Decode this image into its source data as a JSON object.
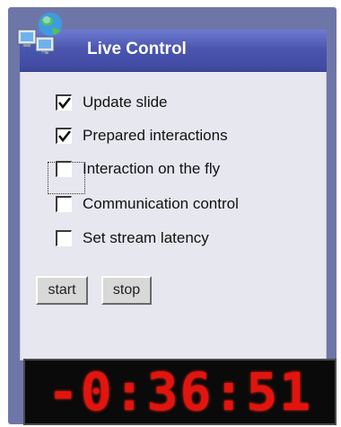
{
  "panel": {
    "title": "Live Control"
  },
  "options": [
    {
      "label": "Update slide",
      "checked": true
    },
    {
      "label": "Prepared interactions",
      "checked": true
    },
    {
      "label": "Interaction on the fly",
      "checked": false,
      "focused": true
    },
    {
      "label": "Communication control",
      "checked": false
    },
    {
      "label": "Set stream latency",
      "checked": false
    }
  ],
  "buttons": {
    "start": "start",
    "stop": "stop"
  },
  "clock": {
    "display": "-0:36:51"
  },
  "colors": {
    "frame": "#6e76a8",
    "header": "#4c56b0",
    "panel_bg": "#e7e7ef",
    "led": "#e2140f"
  },
  "icons": {
    "logo": "networked-computers-globe-icon"
  }
}
